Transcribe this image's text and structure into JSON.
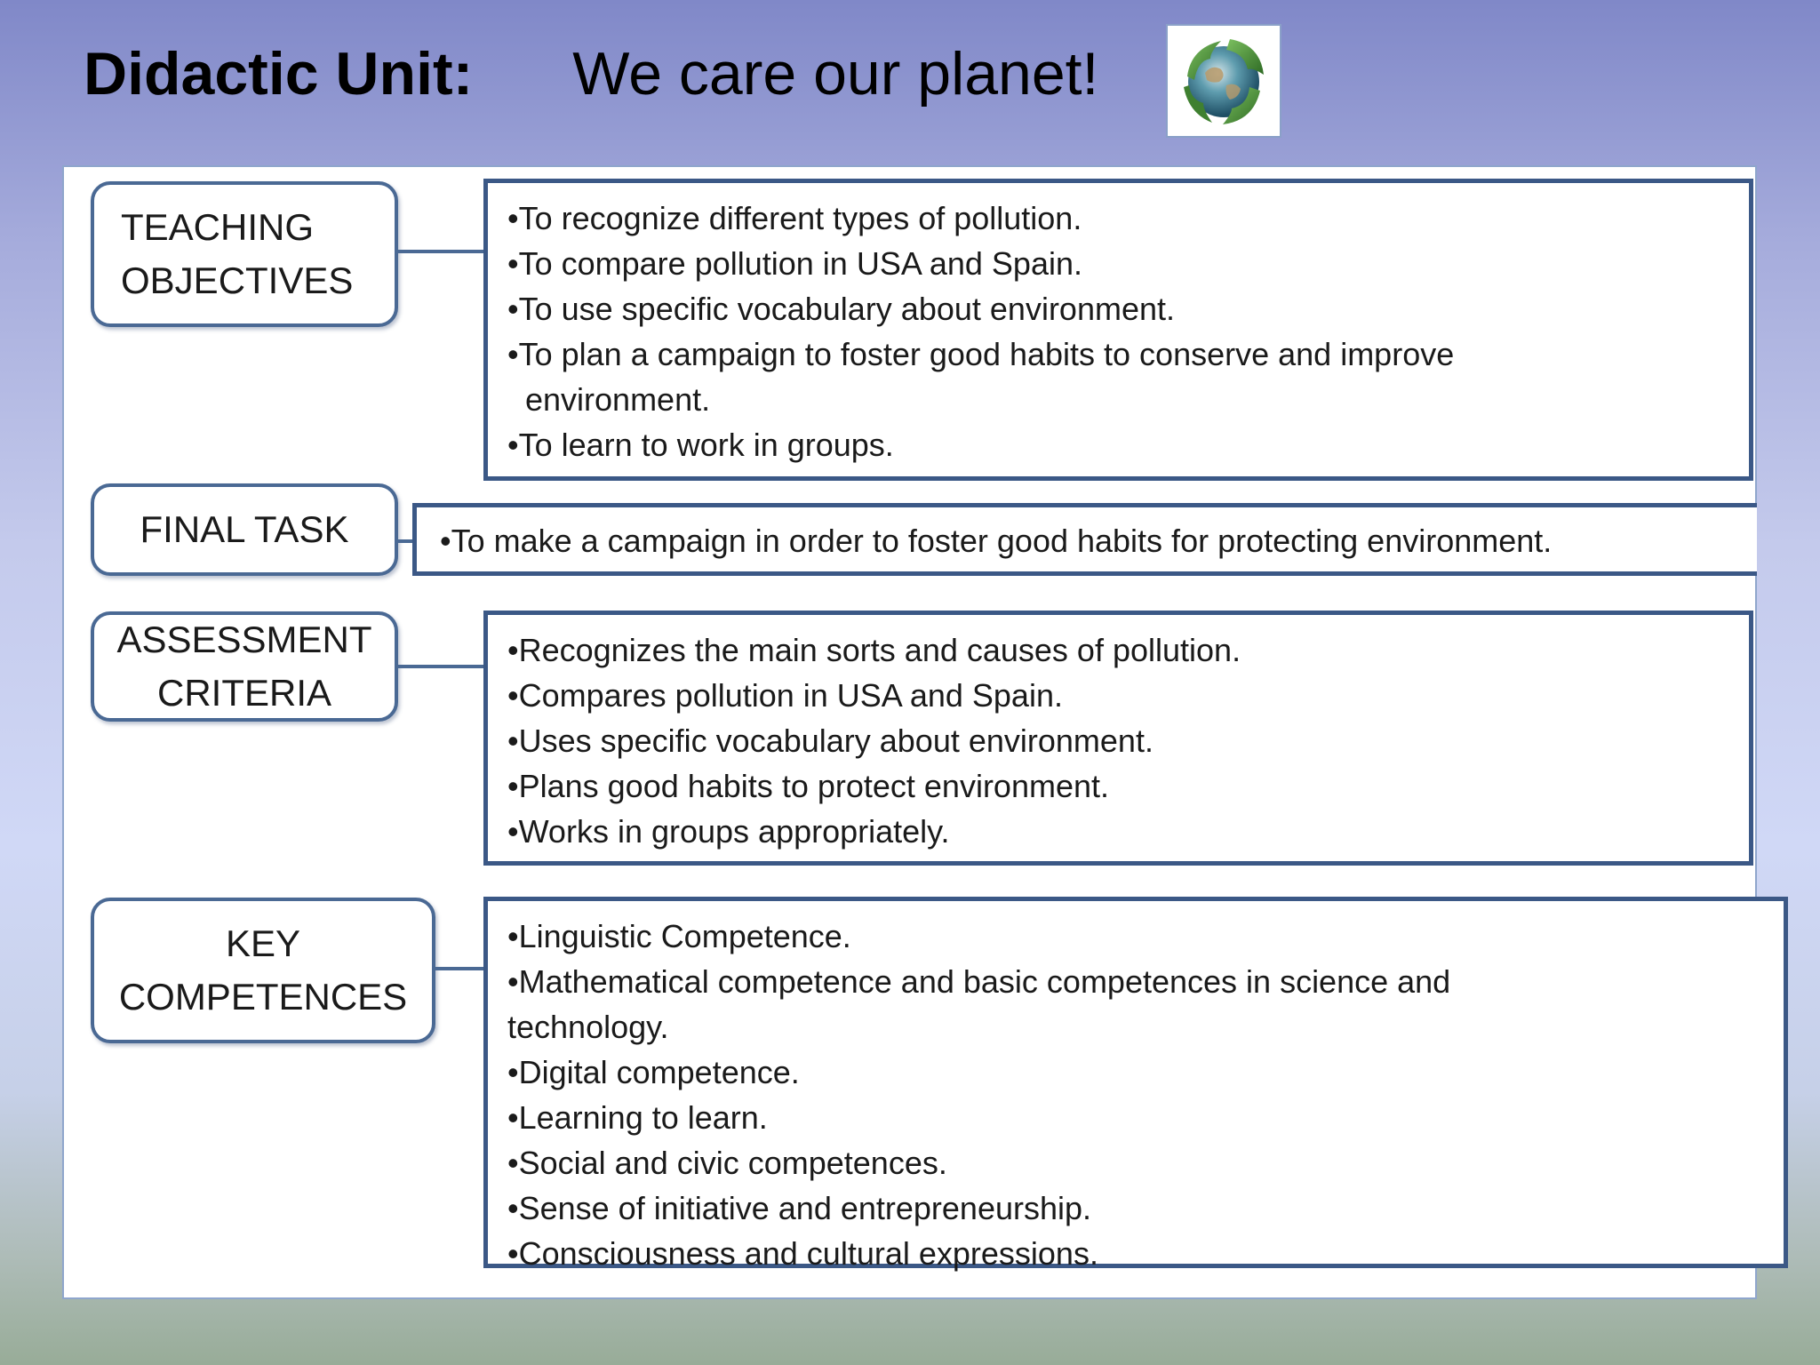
{
  "title": {
    "label": "Didactic Unit:",
    "text": "We care our planet!"
  },
  "sections": {
    "teaching_objectives": {
      "label": "TEACHING\nOBJECTIVES",
      "items": [
        "•To recognize  different types of pollution.",
        "•To compare pollution  in USA and Spain.",
        "•To use specific vocabulary about environment.",
        "•To plan a campaign  to foster good habits to conserve and improve environment.",
        "•To learn to work in groups."
      ]
    },
    "final_task": {
      "label": "FINAL TASK",
      "items": [
        "•To  make a campaign in order to foster good habits for protecting environment."
      ]
    },
    "assessment_criteria": {
      "label": "ASSESSMENT\nCRITERIA",
      "items": [
        "•Recognizes the main sorts and causes of pollution.",
        "•Compares pollution  in USA and Spain.",
        "•Uses specific vocabulary about environment.",
        "•Plans good habits to protect environment.",
        "•Works in groups appropriately."
      ]
    },
    "key_competences": {
      "label": "KEY\nCOMPETENCES",
      "items": [
        "•Linguistic Competence.",
        "•Mathematical competence  and basic competences  in science and technology.",
        "•Digital competence.",
        "•Learning to learn.",
        "•Social and civic competences.",
        "•Sense of initiative and entrepreneurship.",
        "•Consciousness and cultural expressions."
      ]
    }
  },
  "colors": {
    "box_border": "#3b5886",
    "label_border": "#4a6994"
  },
  "icons": {
    "title_image": "recycling-globe-icon"
  }
}
